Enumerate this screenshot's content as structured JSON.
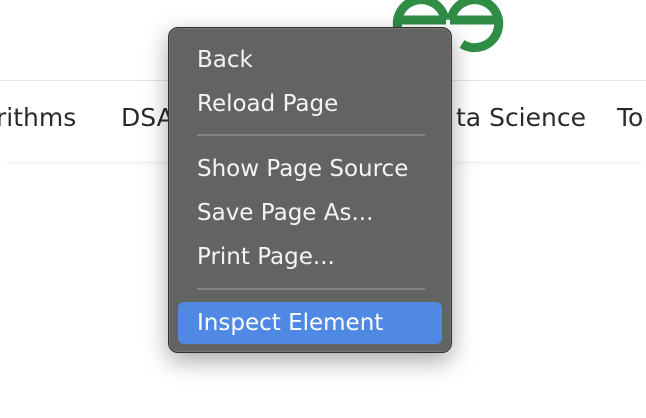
{
  "nav": {
    "items": [
      {
        "label": "rithms"
      },
      {
        "label": "DSA"
      },
      {
        "label": "ta Science"
      },
      {
        "label": "To"
      }
    ]
  },
  "colors": {
    "logo_green": "#2f8d46",
    "menu_background": "#626462",
    "menu_highlight": "#5089e4",
    "menu_text": "#f4f4f4"
  },
  "context_menu": {
    "items": [
      {
        "label": "Back"
      },
      {
        "label": "Reload Page"
      },
      {
        "label": "Show Page Source"
      },
      {
        "label": "Save Page As..."
      },
      {
        "label": "Print Page..."
      },
      {
        "label": "Inspect Element"
      }
    ],
    "highlighted_item": "Inspect Element"
  },
  "logo": {
    "icon": "gfg-logo-icon"
  }
}
